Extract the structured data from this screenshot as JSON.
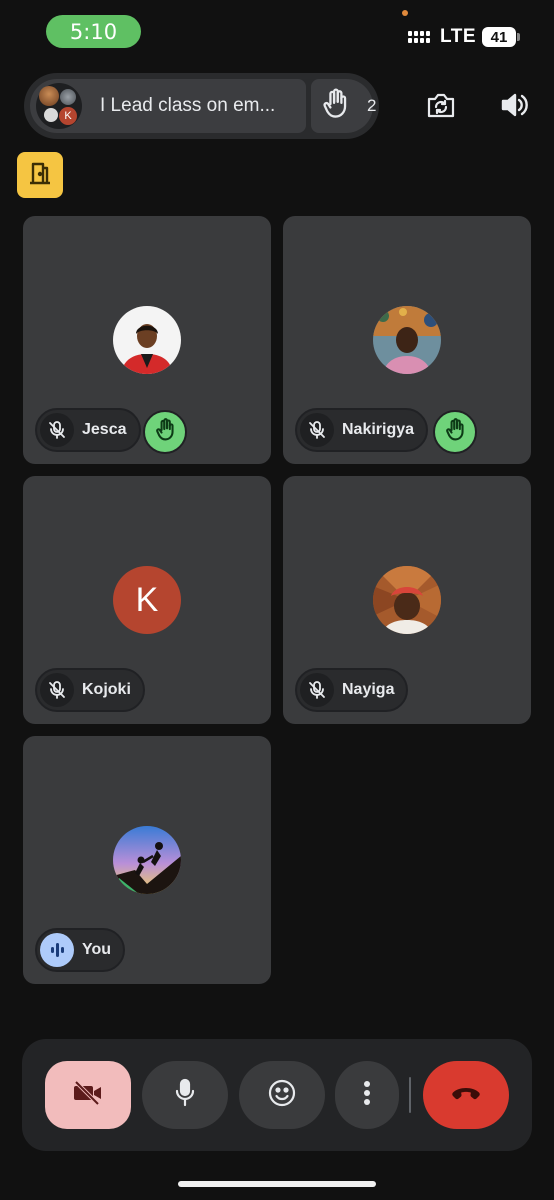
{
  "status_bar": {
    "time": "5:10",
    "network": "LTE",
    "battery": "41"
  },
  "meeting": {
    "title": "I Lead class on em...",
    "hand_count": "2",
    "avatar_letter": "K"
  },
  "participants": [
    {
      "name": "Jesca",
      "muted": true,
      "hand_raised": true
    },
    {
      "name": "Nakirigya",
      "muted": true,
      "hand_raised": true
    },
    {
      "name": "Kojoki",
      "muted": true,
      "hand_raised": false,
      "initial": "K",
      "avatar_color": "#b5452f"
    },
    {
      "name": "Nayiga",
      "muted": true,
      "hand_raised": false
    },
    {
      "name": "You",
      "speaking": true
    }
  ],
  "colors": {
    "background": "#111111",
    "tile": "#3a3b3d",
    "hand_badge": "#6fd37a",
    "end_call": "#d93a2f",
    "camera_off": "#f2bcbc",
    "time_pill": "#5fc063",
    "door_badge": "#f5c542"
  },
  "icons": [
    "hand-raise-icon",
    "camera-switch-icon",
    "speaker-icon",
    "door-icon",
    "mic-off-icon",
    "camera-off-icon",
    "mic-icon",
    "emoji-icon",
    "more-vert-icon",
    "end-call-icon",
    "audio-wave-icon"
  ]
}
